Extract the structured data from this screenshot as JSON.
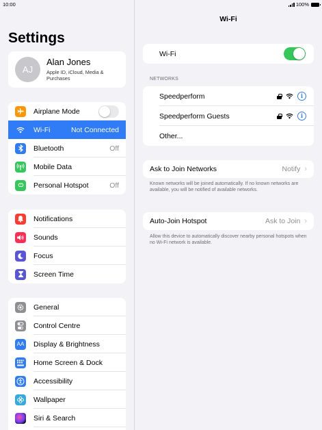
{
  "status_bar": {
    "time": "10:00",
    "battery": "100%"
  },
  "sidebar": {
    "title": "Settings",
    "profile": {
      "initials": "AJ",
      "name": "Alan Jones",
      "subtitle": "Apple ID, iCloud, Media & Purchases"
    },
    "group1": [
      {
        "label": "Airplane Mode",
        "icon": "airplane-icon",
        "color": "#ff9500",
        "control": "toggle-off"
      },
      {
        "label": "Wi-Fi",
        "icon": "wifi-icon",
        "color": "#2f7cf6",
        "value": "Not Connected",
        "selected": true
      },
      {
        "label": "Bluetooth",
        "icon": "bluetooth-icon",
        "color": "#2f7cf6",
        "value": "Off"
      },
      {
        "label": "Mobile Data",
        "icon": "antenna-icon",
        "color": "#34c759"
      },
      {
        "label": "Personal Hotspot",
        "icon": "hotspot-icon",
        "color": "#34c759",
        "value": "Off"
      }
    ],
    "group2": [
      {
        "label": "Notifications",
        "icon": "bell-icon",
        "color": "#ff3b30"
      },
      {
        "label": "Sounds",
        "icon": "speaker-icon",
        "color": "#ff2d55"
      },
      {
        "label": "Focus",
        "icon": "moon-icon",
        "color": "#5856d6"
      },
      {
        "label": "Screen Time",
        "icon": "hourglass-icon",
        "color": "#5856d6"
      }
    ],
    "group3": [
      {
        "label": "General",
        "icon": "gear-icon",
        "color": "#8e8e93"
      },
      {
        "label": "Control Centre",
        "icon": "switches-icon",
        "color": "#8e8e93"
      },
      {
        "label": "Display & Brightness",
        "icon": "text-size-icon",
        "color": "#2f7cf6",
        "glyph": "AA"
      },
      {
        "label": "Home Screen & Dock",
        "icon": "home-grid-icon",
        "color": "#2f7cf6"
      },
      {
        "label": "Accessibility",
        "icon": "accessibility-icon",
        "color": "#2f7cf6"
      },
      {
        "label": "Wallpaper",
        "icon": "flower-icon",
        "color": "#35aadc"
      },
      {
        "label": "Siri & Search",
        "icon": "siri-icon",
        "color": "#222222"
      }
    ]
  },
  "detail": {
    "title": "Wi-Fi",
    "wifi_toggle": {
      "label": "Wi-Fi",
      "state": "on",
      "color": "#34c759"
    },
    "networks_header": "NETWORKS",
    "networks": [
      {
        "name": "Speedperform"
      },
      {
        "name": "Speedperform Guests"
      }
    ],
    "other_label": "Other...",
    "ask_to_join": {
      "label": "Ask to Join Networks",
      "value": "Notify"
    },
    "ask_to_join_note": "Known networks will be joined automatically. If no known networks are available, you will be notified of available networks.",
    "auto_join": {
      "label": "Auto-Join Hotspot",
      "value": "Ask to Join"
    },
    "auto_join_note": "Allow this device to automatically discover nearby personal hotspots when no Wi-Fi network is available."
  }
}
